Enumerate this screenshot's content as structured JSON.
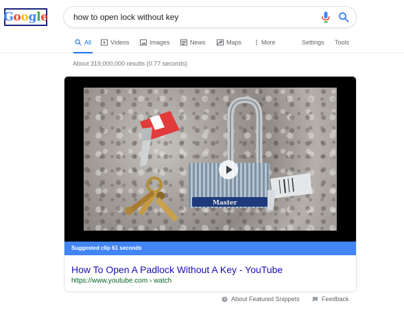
{
  "logo": {
    "letters": [
      "G",
      "o",
      "o",
      "g",
      "l",
      "e"
    ],
    "colors": [
      "#4285f4",
      "#ea4335",
      "#fbbc05",
      "#4285f4",
      "#34a853",
      "#ea4335"
    ]
  },
  "search": {
    "query": "how to open lock without key",
    "mic_icon": "mic-icon",
    "search_icon": "search-icon"
  },
  "tabs": [
    {
      "label": "All",
      "icon": "search-icon",
      "active": true
    },
    {
      "label": "Videos",
      "icon": "play-icon"
    },
    {
      "label": "Images",
      "icon": "image-icon"
    },
    {
      "label": "News",
      "icon": "news-icon"
    },
    {
      "label": "Maps",
      "icon": "map-icon"
    },
    {
      "label": "More",
      "icon": "more-vert-icon"
    }
  ],
  "tools": {
    "settings": "Settings",
    "tools": "Tools"
  },
  "results_count": "About 319,000,000 results (0.77 seconds)",
  "snippet": {
    "suggested_clip": "Suggested clip 61 seconds",
    "padlock_brand": "Master",
    "title": "How To Open A Padlock Without A Key - YouTube",
    "url": "https://www.youtube.com › watch"
  },
  "footer": {
    "about": "About Featured Snippets",
    "feedback": "Feedback"
  },
  "colors": {
    "accent": "#1a73e8",
    "link": "#1a0dab",
    "url_green": "#006621",
    "clip_bar": "#4285f4"
  }
}
